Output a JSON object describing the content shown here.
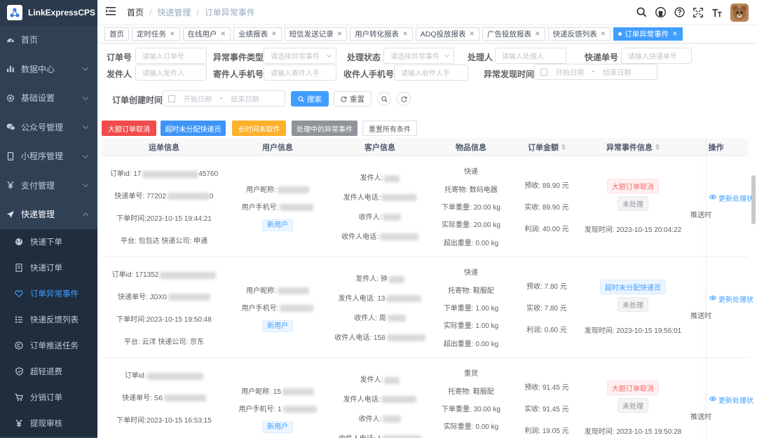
{
  "app": {
    "title": "LinkExpressCPS"
  },
  "sidebar": {
    "items": [
      {
        "label": "首页",
        "icon": "dashboard-icon"
      },
      {
        "label": "数据中心",
        "icon": "bar-chart-icon",
        "has_children": true
      },
      {
        "label": "基础设置",
        "icon": "gear-icon",
        "has_children": true
      },
      {
        "label": "公众号管理",
        "icon": "wechat-icon",
        "has_children": true
      },
      {
        "label": "小程序管理",
        "icon": "phone-icon",
        "has_children": true
      },
      {
        "label": "支付管理",
        "icon": "yen-icon",
        "has_children": true
      },
      {
        "label": "快递管理",
        "icon": "send-icon",
        "has_children": true,
        "expanded": true
      }
    ],
    "subitems": [
      {
        "label": "快递下单",
        "icon": "globe-icon"
      },
      {
        "label": "快递订单",
        "icon": "document-icon"
      },
      {
        "label": "订单异常事件",
        "icon": "heart-icon",
        "active": true
      },
      {
        "label": "快递反馈列表",
        "icon": "list-icon"
      },
      {
        "label": "订单推送任务",
        "icon": "copyright-icon"
      },
      {
        "label": "超轻退费",
        "icon": "shield-icon"
      },
      {
        "label": "分销订单",
        "icon": "cart-icon"
      },
      {
        "label": "提现审核",
        "icon": "yen-icon"
      }
    ]
  },
  "header": {
    "breadcrumb": [
      "首页",
      "快递管理",
      "订单异常事件"
    ]
  },
  "tags": [
    {
      "label": "首页",
      "closable": false
    },
    {
      "label": "定时任务",
      "closable": true
    },
    {
      "label": "在线用户",
      "closable": true
    },
    {
      "label": "业绩报表",
      "closable": true
    },
    {
      "label": "短信发送记录",
      "closable": true
    },
    {
      "label": "用户转化报表",
      "closable": true
    },
    {
      "label": "ADQ投放报表",
      "closable": true
    },
    {
      "label": "广告投放报表",
      "closable": true
    },
    {
      "label": "快递反馈列表",
      "closable": true
    },
    {
      "label": "订单异常事件",
      "closable": true,
      "active": true
    }
  ],
  "filters": {
    "order_no": {
      "label": "订单号",
      "placeholder": "请输入订单号"
    },
    "event_type": {
      "label": "异常事件类型",
      "placeholder": "请选择异常事件"
    },
    "status": {
      "label": "处理状态",
      "placeholder": "请选择异常事件"
    },
    "handler": {
      "label": "处理人",
      "placeholder": "请输入处理人"
    },
    "express_no": {
      "label": "快递单号",
      "placeholder": "请输入快递单号"
    },
    "sender": {
      "label": "发件人",
      "placeholder": "请输入发件人"
    },
    "sender_phone": {
      "label": "寄件人手机号",
      "placeholder": "请输入寄件人手"
    },
    "receiver_phone": {
      "label": "收件人手机号",
      "placeholder": "请输入收件人手"
    },
    "found_time": {
      "label": "异常发现时间",
      "start": "开始日期",
      "end": "结束日期",
      "dash": "-"
    },
    "created_time": {
      "label": "订单创建时间",
      "start": "开始日期",
      "end": "结束日期",
      "dash": "-"
    },
    "search_label": "搜索",
    "reset_label": "重置"
  },
  "quick_filters": [
    {
      "label": "大额订单取消",
      "color": "#f24b4b"
    },
    {
      "label": "超时未分配快递员",
      "color": "#3e95f7"
    },
    {
      "label": "长时间未取件",
      "color": "#fdb12a"
    },
    {
      "label": "处理中的异常事件",
      "color": "#909399"
    },
    {
      "label": "重置所有条件",
      "color": "#ffffff"
    }
  ],
  "table": {
    "columns": [
      "运单信息",
      "用户信息",
      "客户信息",
      "物品信息",
      "订单金额",
      "异常事件信息",
      "操作"
    ],
    "rows": [
      {
        "waybill": {
          "order_id": "订单id: 17",
          "express_no": "快递单号: 77202",
          "express_tail": "0",
          "order_time": "下单时间:2023-10-15 19:44:21",
          "platform": "平台: 包包达 快递公司: 申通",
          "order_id_tail": "45760"
        },
        "user": {
          "nick": "用户昵称:",
          "phone": "用户手机号:",
          "badge": "新用户"
        },
        "customer": {
          "sender": "发件人:",
          "sender_phone": "发件人电话:",
          "receiver": "收件人:",
          "receiver_phone": "收件人电话:"
        },
        "goods": {
          "type": "快递",
          "item": "托寄物: 数码电器",
          "order_weight": "下单重量: 20.00 kg",
          "actual_weight": "实际重量: 20.00 kg",
          "over_weight": "超出重量: 0.00 kg"
        },
        "amount": {
          "pre": "预收: 89.90 元",
          "actual": "实收: 89.90 元",
          "profit": "利润: 40.00 元"
        },
        "event": {
          "type": "大额订单取消",
          "type_style": "red",
          "status": "未处理",
          "found": "发现时间: 2023-10-15 20:04:22"
        },
        "push": "推送时",
        "action": "更新处理状"
      },
      {
        "waybill": {
          "order_id": "订单id: 171352",
          "express_no": "快递单号: JDX0",
          "express_tail": "",
          "order_time": "下单时间:2023-10-15 19:50:48",
          "platform": "平台: 云洋 快递公司: 京东",
          "order_id_tail": ""
        },
        "user": {
          "nick": "用户昵称:",
          "phone": "用户手机号:",
          "badge": "新用户"
        },
        "customer": {
          "sender": "发件人: 钟",
          "sender_phone": "发件人电话: 13",
          "receiver": "收件人: 周",
          "receiver_phone": "收件人电话: 158"
        },
        "goods": {
          "type": "快递",
          "item": "托寄物: 鞋服配",
          "order_weight": "下单重量: 1.00 kg",
          "actual_weight": "实际重量: 1.00 kg",
          "over_weight": "超出重量: 0.00 kg"
        },
        "amount": {
          "pre": "预收: 7.80 元",
          "actual": "实收: 7.80 元",
          "profit": "利润: 0.60 元"
        },
        "event": {
          "type": "超时未分配快递员",
          "type_style": "blue",
          "status": "未处理",
          "found": "发现时间: 2023-10-15 19:56:01"
        },
        "push": "推送时",
        "action": "更新处理状"
      },
      {
        "waybill": {
          "order_id": "订单id:",
          "express_no": "快递单号: S6",
          "express_tail": "",
          "order_time": "下单时间:2023-10-15 16:53:15",
          "platform": "平台: 云洋 快递公司: 顺心捷达",
          "order_id_tail": ""
        },
        "user": {
          "nick": "用户昵称: 15",
          "phone": "用户手机号: 1",
          "badge": "新用户"
        },
        "customer": {
          "sender": "发件人:",
          "sender_phone": "发件人电话:",
          "receiver": "收件人:",
          "receiver_phone": "收件人电话: 1"
        },
        "goods": {
          "type": "重货",
          "item": "托寄物: 鞋服配",
          "order_weight": "下单重量: 30.00 kg",
          "actual_weight": "实际重量: 0.00 kg",
          "over_weight": "超出重量: 0.00 kg"
        },
        "amount": {
          "pre": "预收: 91.45 元",
          "actual": "实收: 91.45 元",
          "profit": "利润: 19.05 元"
        },
        "event": {
          "type": "大额订单取消",
          "type_style": "red",
          "status": "未处理",
          "found": "发现时间: 2023-10-15 19:50:28"
        },
        "push": "推送时",
        "action": "更新处理状"
      }
    ]
  }
}
